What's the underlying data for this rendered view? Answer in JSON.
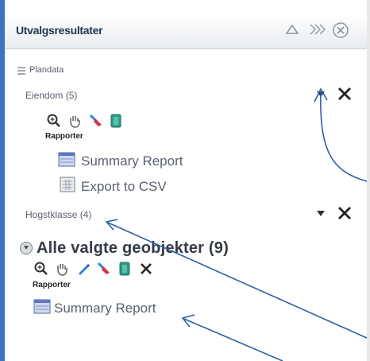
{
  "panel": {
    "title": "Utvalgsresultater",
    "header_buttons": [
      "collapse-icon",
      "forward-icon",
      "close-circle-icon"
    ]
  },
  "tree": {
    "root_label": "Plandata",
    "groups": [
      {
        "label": "Eiendom (5)",
        "toolbar_icons": [
          "zoom-icon",
          "pan-hand-icon",
          "highlight-icon",
          "report-icon"
        ],
        "reports_label": "Rapporter",
        "reports": [
          "Summary Report",
          "Export to CSV"
        ]
      },
      {
        "label": "Hogstklasse (4)"
      }
    ]
  },
  "all_selected": {
    "label": "Alle valgte geobjekter (9)",
    "toolbar_icons": [
      "zoom-icon",
      "pan-hand-icon",
      "edit-icon",
      "highlight-icon",
      "report-icon",
      "clear-icon"
    ],
    "reports_label": "Rapporter",
    "reports": [
      "Summary Report"
    ]
  },
  "colors": {
    "accent": "#3c73c2",
    "arrow": "#2f5fa8"
  }
}
